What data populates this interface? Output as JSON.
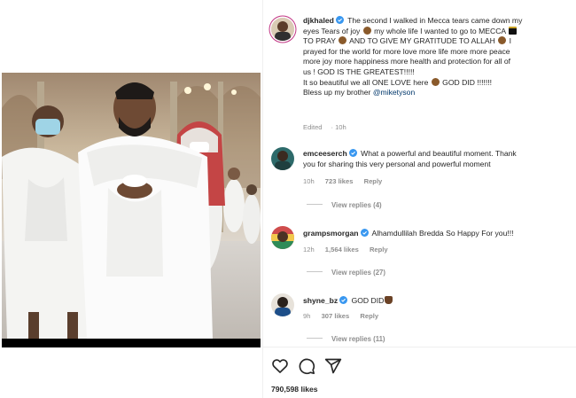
{
  "post": {
    "author": "djkhaled",
    "caption_lines": [
      "The second I walked in Mecca tears came down my",
      "eyes Tears of joy",
      "my whole life I wanted to go to MECCA",
      "TO PRAY",
      "AND TO GIVE MY GRATITUDE TO ALLAH",
      "I",
      "prayed for the world for more love more life more more peace",
      "more joy more happiness more health and protection for all of",
      "us ! GOD IS THE GREATEST!!!!!",
      "It so beautiful we all ONE LOVE here",
      "GOD DID !!!!!!!",
      "Bless up my brother",
      "@miketyson"
    ],
    "edited_label": "Edited",
    "edited_time": "10h"
  },
  "comments": [
    {
      "username": "emceeserch",
      "text_line1": "What a powerful and beautiful moment. Thank",
      "text_line2": "you for sharing this very personal and powerful moment",
      "time": "10h",
      "likes": "723 likes",
      "reply": "Reply",
      "view_replies": "View replies (4)"
    },
    {
      "username": "grampsmorgan",
      "text": "Alhamdullilah Bredda So Happy For you!!!",
      "time": "12h",
      "likes": "1,564 likes",
      "reply": "Reply",
      "view_replies": "View replies (27)"
    },
    {
      "username": "shyne_bz",
      "text": "GOD DID",
      "time": "9h",
      "likes": "307 likes",
      "reply": "Reply",
      "view_replies": "View replies (11)"
    }
  ],
  "actions": {
    "icons": [
      "heart-icon",
      "comment-icon",
      "share-icon"
    ],
    "like_count": "790,598 likes"
  },
  "colors": {
    "verified_blue": "#3897f0",
    "muted_text": "#8e8e8e",
    "mention_link": "#00376b",
    "photo_background": "#000000"
  }
}
